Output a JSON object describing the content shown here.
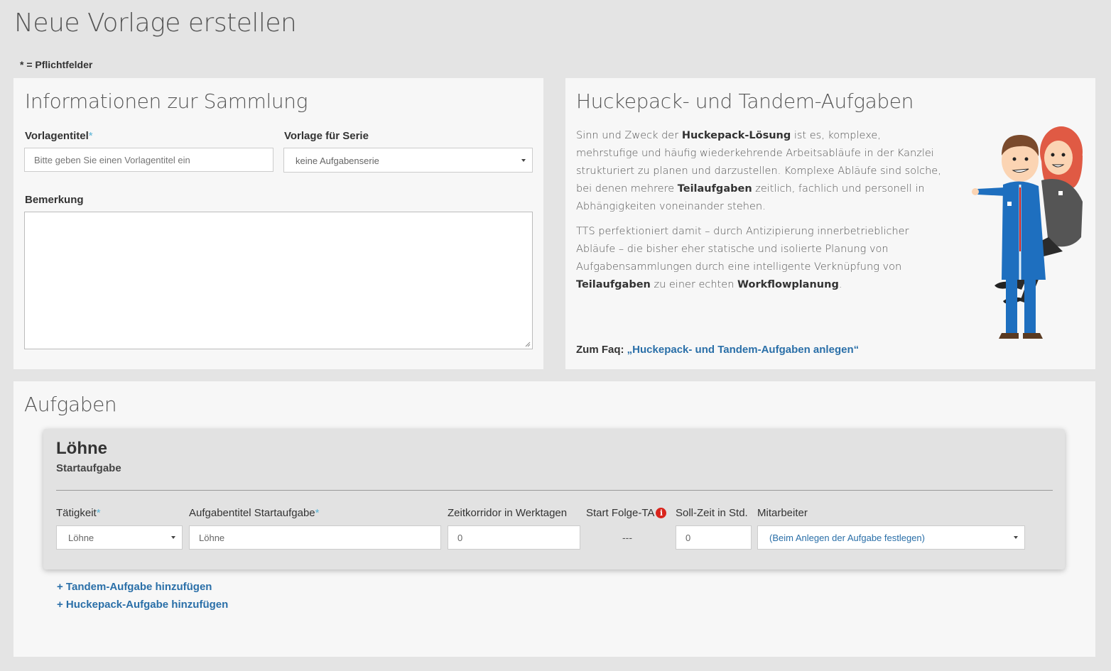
{
  "page": {
    "title": "Neue Vorlage erstellen",
    "required_note": "* = Pflichtfelder"
  },
  "info_panel": {
    "title": "Informationen zur Sammlung",
    "vorlagentitel": {
      "label": "Vorlagentitel",
      "required_mark": "*",
      "placeholder": "Bitte geben Sie einen Vorlagentitel ein"
    },
    "serie": {
      "label": "Vorlage für Serie",
      "selected": "keine Aufgabenserie"
    },
    "bemerkung": {
      "label": "Bemerkung",
      "value": ""
    }
  },
  "huckepack_panel": {
    "title": "Huckepack- und Tandem-Aufgaben",
    "p1": {
      "t1": "Sinn und Zweck der ",
      "b1": "Huckepack-Lösung",
      "t2": " ist es, komplexe, mehrstufige und häufig wiederkehrende Arbeitsabläufe in der Kanzlei strukturiert zu planen und darzustellen. Komplexe Abläufe sind solche, bei denen mehrere ",
      "b2": "Teilaufgaben",
      "t3": " zeitlich, fachlich und personell in Abhängigkeiten voneinander stehen."
    },
    "p2": {
      "t1": "TTS perfektioniert damit – durch Antizipierung innerbetrieblicher Abläufe – die bisher eher statische und isolierte Planung von Aufgabensammlungen durch eine intelligente Verknüpfung von ",
      "b1": "Teilaufgaben",
      "t2": " zu einer echten ",
      "b2": "Workflowplanung",
      "t3": "."
    },
    "faq_prefix": "Zum Faq: ",
    "faq_link": "„Huckepack- und Tandem-Aufgaben anlegen“"
  },
  "aufgaben_panel": {
    "title": "Aufgaben",
    "task": {
      "title": "Löhne",
      "subtitle": "Startaufgabe",
      "columns": {
        "taetigkeit": "Tätigkeit",
        "aufgabentitel": "Aufgabentitel Startaufgabe",
        "zeitkorridor": "Zeitkorridor in Werktagen",
        "start_folge": "Start Folge-TA",
        "soll_zeit": "Soll-Zeit in Std.",
        "mitarbeiter": "Mitarbeiter"
      },
      "required_mark": "*",
      "values": {
        "taetigkeit": "Löhne",
        "aufgabentitel": "Löhne",
        "zeitkorridor": "0",
        "start_folge": "---",
        "soll_zeit": "0",
        "mitarbeiter": "(Beim Anlegen der Aufgabe festlegen)"
      }
    },
    "add_tandem": "+ Tandem-Aufgabe hinzufügen",
    "add_huckepack": "+ Huckepack-Aufgabe hinzufügen"
  },
  "colors": {
    "link": "#2a6fa8",
    "required": "#5ab4d6",
    "info_icon": "#d9251d",
    "background": "#e4e4e4",
    "panel": "#f7f7f7"
  },
  "icons": {
    "info": "info-icon",
    "dropdown": "chevron-down-icon"
  }
}
